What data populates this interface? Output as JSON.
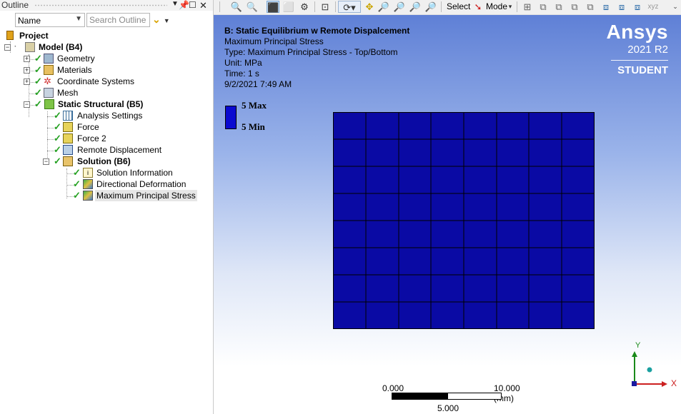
{
  "outline": {
    "title": "Outline",
    "filter_select": "Name",
    "search_placeholder": "Search Outline",
    "tree": [
      {
        "label": "Project",
        "level": 0,
        "bold": true
      },
      {
        "label": "Model (B4)",
        "level": 1,
        "bold": true
      },
      {
        "label": "Geometry",
        "level": 2
      },
      {
        "label": "Materials",
        "level": 2
      },
      {
        "label": "Coordinate Systems",
        "level": 2
      },
      {
        "label": "Mesh",
        "level": 2
      },
      {
        "label": "Static Structural (B5)",
        "level": 2,
        "bold": true
      },
      {
        "label": "Analysis Settings",
        "level": 3
      },
      {
        "label": "Force",
        "level": 3
      },
      {
        "label": "Force 2",
        "level": 3
      },
      {
        "label": "Remote Displacement",
        "level": 3
      },
      {
        "label": "Solution (B6)",
        "level": 3,
        "bold": true
      },
      {
        "label": "Solution Information",
        "level": 4
      },
      {
        "label": "Directional Deformation",
        "level": 4
      },
      {
        "label": "Maximum Principal Stress",
        "level": 4,
        "selected": true
      }
    ]
  },
  "toolbar": {
    "select_label": "Select",
    "mode_label": "Mode"
  },
  "viewport": {
    "info": {
      "title": "B: Static Equilibrium w Remote Dispalcement",
      "result": "Maximum Principal Stress",
      "type": "Type: Maximum Principal Stress - Top/Bottom",
      "unit": "Unit: MPa",
      "time": "Time: 1 s",
      "date": "9/2/2021 7:49 AM"
    },
    "brand": {
      "name": "Ansys",
      "version": "2021 R2",
      "edition": "STUDENT"
    },
    "legend": {
      "max": "5 Max",
      "min": "5 Min",
      "color": "#0a0ad0"
    },
    "mesh_color": "#0a0aa4",
    "scale": {
      "start": "0.000",
      "end": "10.000 (mm)",
      "mid": "5.000"
    },
    "triad": {
      "x": "X",
      "y": "Y"
    }
  }
}
